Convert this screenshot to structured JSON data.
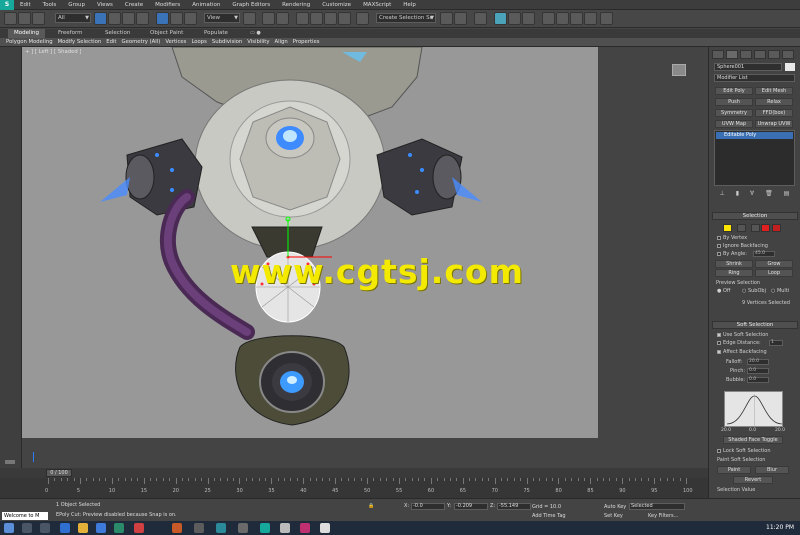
{
  "menu": {
    "logo": "S",
    "items": [
      "Edit",
      "Tools",
      "Group",
      "Views",
      "Create",
      "Modifiers",
      "Animation",
      "Graph Editors",
      "Rendering",
      "Customize",
      "MAXScript",
      "Help"
    ]
  },
  "toolbar": {
    "filter_dropdown": "All",
    "refcoord_dropdown": "View",
    "selection_set_dropdown": "Create Selection Se"
  },
  "ribbon": {
    "tabs": [
      "Modeling",
      "Freeform",
      "Selection",
      "Object Paint",
      "Populate"
    ],
    "active_tab": "Modeling",
    "subtabs": [
      "Polygon Modeling",
      "Modify Selection",
      "Edit",
      "Geometry (All)",
      "Vertices",
      "Loops",
      "Subdivision",
      "Visibility",
      "Align",
      "Properties"
    ]
  },
  "viewport": {
    "label": "+ ] [ Left ] [ Shaded ]",
    "watermark": "www.cgtsj.com"
  },
  "command_panel": {
    "object_name": "Sphere001",
    "modifier_list": "Modifier List",
    "modifier_buttons": [
      "Edit Poly",
      "Edit Mesh",
      "Push",
      "Relax",
      "Symmetry",
      "FFD(box)",
      "UVW Map",
      "Unwrap UVW"
    ],
    "stack_item": "Editable Poly",
    "selection": {
      "header": "Selection",
      "by_vertex": "By Vertex",
      "ignore_backfacing": "Ignore Backfacing",
      "by_angle": "By Angle:",
      "by_angle_value": "45.0",
      "shrink": "Shrink",
      "grow": "Grow",
      "ring": "Ring",
      "loop": "Loop",
      "preview_label": "Preview Selection",
      "preview_off": "Off",
      "preview_subobj": "SubObj",
      "preview_multi": "Multi",
      "status": "9 Vertices Selected"
    },
    "soft_selection": {
      "header": "Soft Selection",
      "use_soft": "Use Soft Selection",
      "edge_distance": "Edge Distance:",
      "edge_distance_value": "1",
      "affect_backfacing": "Affect Backfacing",
      "falloff": "Falloff:",
      "falloff_value": "20.0",
      "pinch": "Pinch:",
      "pinch_value": "0.0",
      "bubble": "Bubble:",
      "bubble_value": "0.0",
      "curve_left": "20.0",
      "curve_mid": "0.0",
      "curve_right": "20.0",
      "shaded_face_toggle": "Shaded Face Toggle",
      "lock_soft": "Lock Soft Selection",
      "paint_soft": "Paint Soft Selection",
      "paint": "Paint",
      "blur": "Blur",
      "revert": "Revert",
      "selection_value": "Selection Value"
    }
  },
  "timeline": {
    "frame_display": "0 / 100",
    "ticks": [
      "0",
      "5",
      "10",
      "15",
      "20",
      "25",
      "30",
      "35",
      "40",
      "45",
      "50",
      "55",
      "60",
      "65",
      "70",
      "75",
      "80",
      "85",
      "90",
      "95",
      "100"
    ]
  },
  "status": {
    "welcome": "Welcome to M",
    "line1": "1 Object Selected",
    "line2": "EPoly Cut: Preview disabled because Snap is on.",
    "x_label": "X:",
    "x_value": "-0.0",
    "y_label": "Y:",
    "y_value": "-0.209",
    "z_label": "Z:",
    "z_value": "-55.149",
    "grid": "Grid = 10.0",
    "add_time_tag": "Add Time Tag",
    "auto_key": "Auto Key",
    "auto_key_dropdown": "Selected",
    "set_key": "Set Key",
    "key_filters": "Key Filters..."
  },
  "taskbar": {
    "clock": "11:20 PM"
  }
}
